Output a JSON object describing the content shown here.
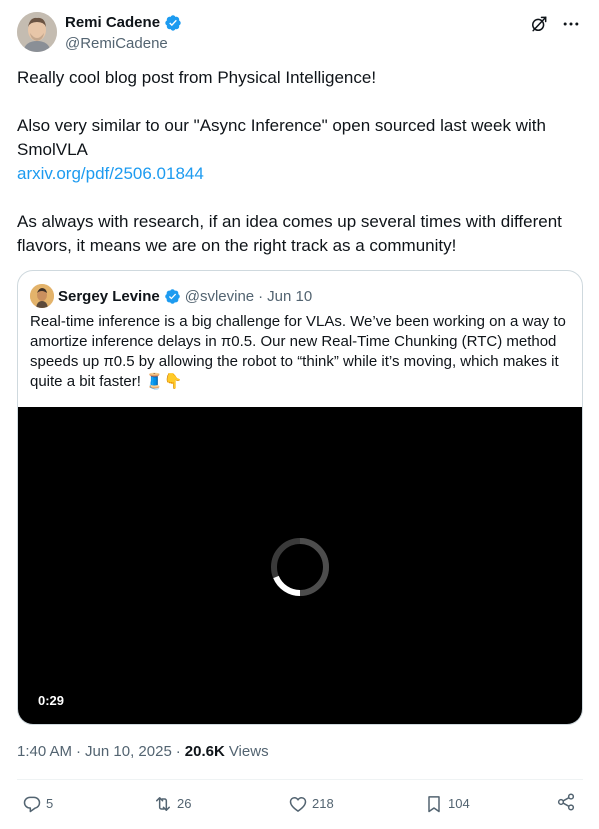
{
  "author": {
    "display_name": "Remi Cadene",
    "handle": "@RemiCadene",
    "avatar_icon": "person-avatar",
    "verified_icon": "verified-badge-icon"
  },
  "header_icons": [
    "grok-icon",
    "more-icon"
  ],
  "tweet": {
    "line1": "Really cool blog post from Physical Intelligence!",
    "line2a": "Also very similar to our \"Async Inference\" open sourced last week with",
    "line2b": "SmolVLA",
    "link": "arxiv.org/pdf/2506.01844",
    "line3a": "As always with research, if an idea comes up several times with different",
    "line3b": "flavors, it means we are on the right track as a community!"
  },
  "quote": {
    "display_name": "Sergey Levine",
    "handle": "@svlevine",
    "separator": "·",
    "date": "Jun 10",
    "text": "Real-time inference is a big challenge for VLAs. We’ve been working on a way to amortize inference delays in π0.5. Our new Real-Time Chunking (RTC) method speeds up π0.5 by allowing the robot to “think” while it’s moving, which makes it quite a bit faster! 🧵👇",
    "video_duration": "0:29"
  },
  "meta": {
    "time": "1:40 AM",
    "date": "Jun 10, 2025",
    "separator": "·",
    "views_count": "20.6K",
    "views_label": "Views"
  },
  "actions": {
    "replies": "5",
    "reposts": "26",
    "likes": "218",
    "bookmarks": "104"
  },
  "colors": {
    "accent": "#1d9bf0",
    "text": "#0f1419",
    "secondary": "#536471",
    "border": "#cfd9de"
  }
}
